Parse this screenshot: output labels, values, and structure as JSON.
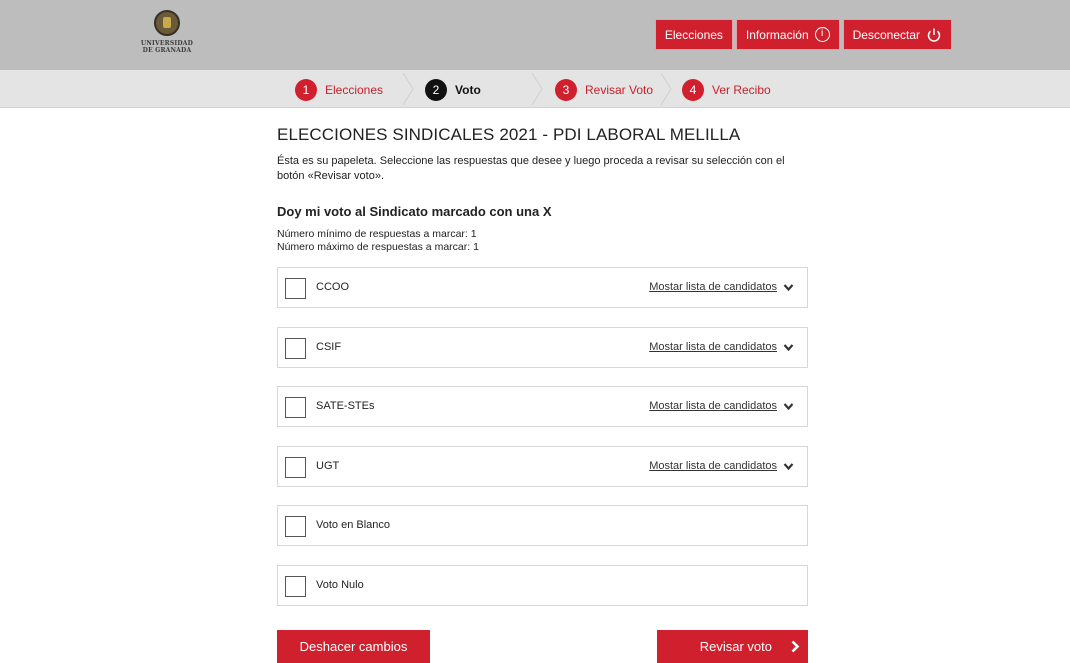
{
  "header": {
    "logo_line1": "UNIVERSIDAD",
    "logo_line2": "DE GRANADA",
    "nav": {
      "elecciones": "Elecciones",
      "informacion": "Información",
      "desconectar": "Desconectar"
    }
  },
  "steps": [
    {
      "num": "1",
      "label": "Elecciones"
    },
    {
      "num": "2",
      "label": "Voto"
    },
    {
      "num": "3",
      "label": "Revisar Voto"
    },
    {
      "num": "4",
      "label": "Ver Recibo"
    }
  ],
  "ballot": {
    "title": "ELECCIONES SINDICALES 2021 - PDI LABORAL MELILLA",
    "intro": "Ésta es su papeleta. Seleccione las respuestas que desee y luego proceda a revisar su selección con el botón «Revisar voto».",
    "question": "Doy mi voto al Sindicato marcado con una X",
    "min_text": "Número mínimo de respuestas a marcar: 1",
    "max_text": "Número máximo de respuestas a marcar: 1",
    "show_list_label": "Mostar lista de candidatos",
    "options": [
      {
        "label": "CCOO"
      },
      {
        "label": "CSIF"
      },
      {
        "label": "SATE-STEs"
      },
      {
        "label": "UGT"
      },
      {
        "label": "Voto en Blanco"
      },
      {
        "label": "Voto Nulo"
      }
    ]
  },
  "actions": {
    "undo": "Deshacer cambios",
    "review": "Revisar voto"
  },
  "colors": {
    "accent": "#d0202e",
    "header_bg": "#bdbdbd",
    "steps_bg": "#e4e4e4"
  }
}
